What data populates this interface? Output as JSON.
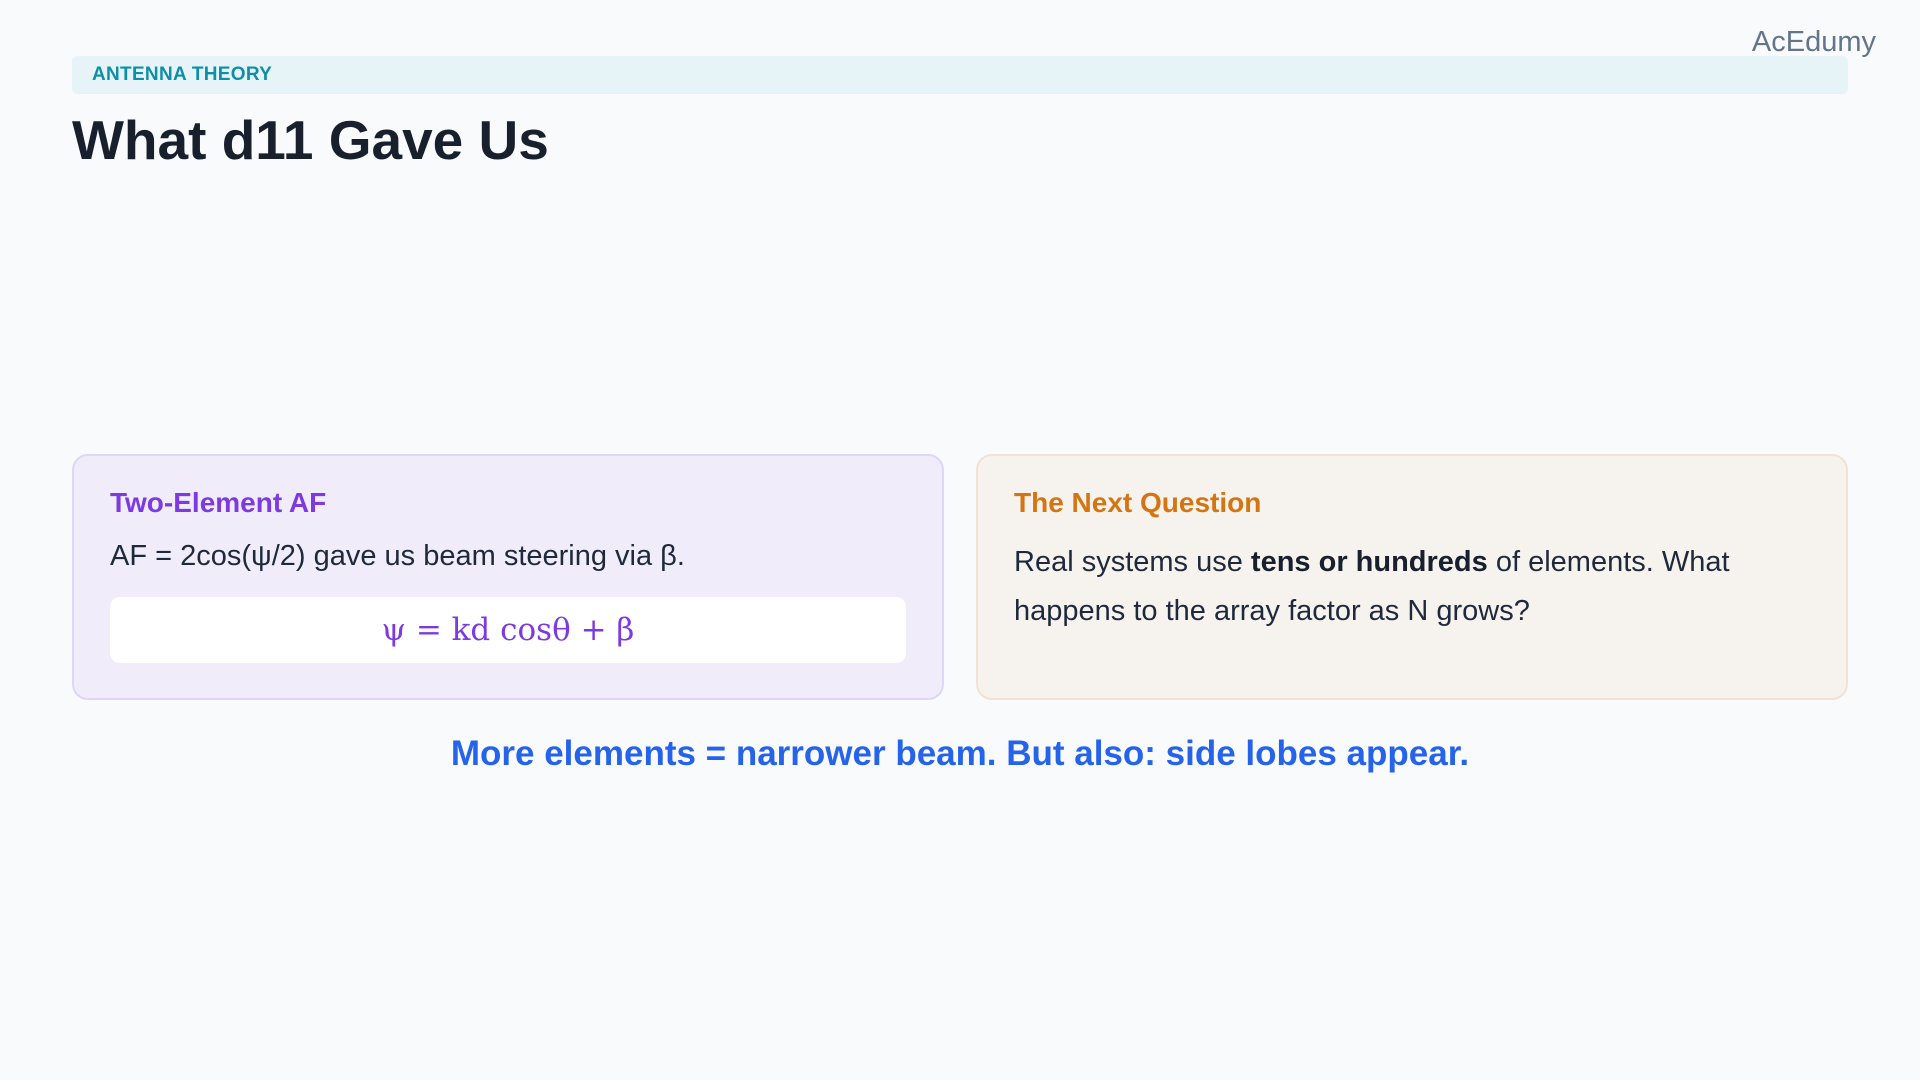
{
  "brand": "AcEdumy",
  "section_tag": "ANTENNA THEORY",
  "title": "What d11 Gave Us",
  "left_card": {
    "heading": "Two-Element AF",
    "text": "AF = 2cos(ψ/2) gave us beam steering via β.",
    "formula": "ψ = kd cosθ + β"
  },
  "right_card": {
    "heading": "The Next Question",
    "text_before": "Real systems use ",
    "text_bold": "tens or hundreds",
    "text_after": " of elements. What happens to the array factor as N grows?"
  },
  "takeaway": "More elements = narrower beam. But also: side lobes appear.",
  "colors": {
    "background": "#f8fafc",
    "tag_bg": "#e6f4f8",
    "tag_text": "#0e8fa8",
    "purple_accent": "#7c3ae0",
    "orange_accent": "#d47511",
    "blue_accent": "#2563eb"
  }
}
